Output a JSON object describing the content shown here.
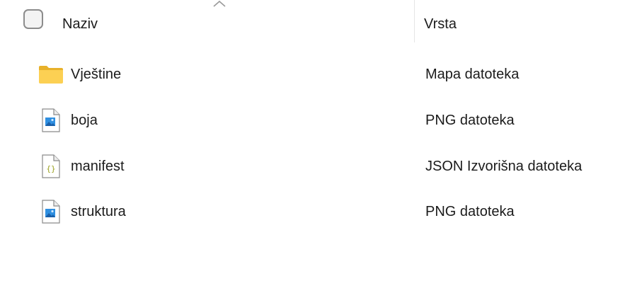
{
  "header": {
    "name_label": "Naziv",
    "type_label": "Vrsta"
  },
  "rows": [
    {
      "name": "Vještine",
      "type": "Mapa datoteka",
      "icon": "folder-icon"
    },
    {
      "name": "boja",
      "type": "PNG datoteka",
      "icon": "image-file-icon"
    },
    {
      "name": "manifest",
      "type": "JSON Izvorišna datoteka",
      "icon": "json-file-icon"
    },
    {
      "name": "struktura",
      "type": "PNG datoteka",
      "icon": "image-file-icon"
    }
  ]
}
